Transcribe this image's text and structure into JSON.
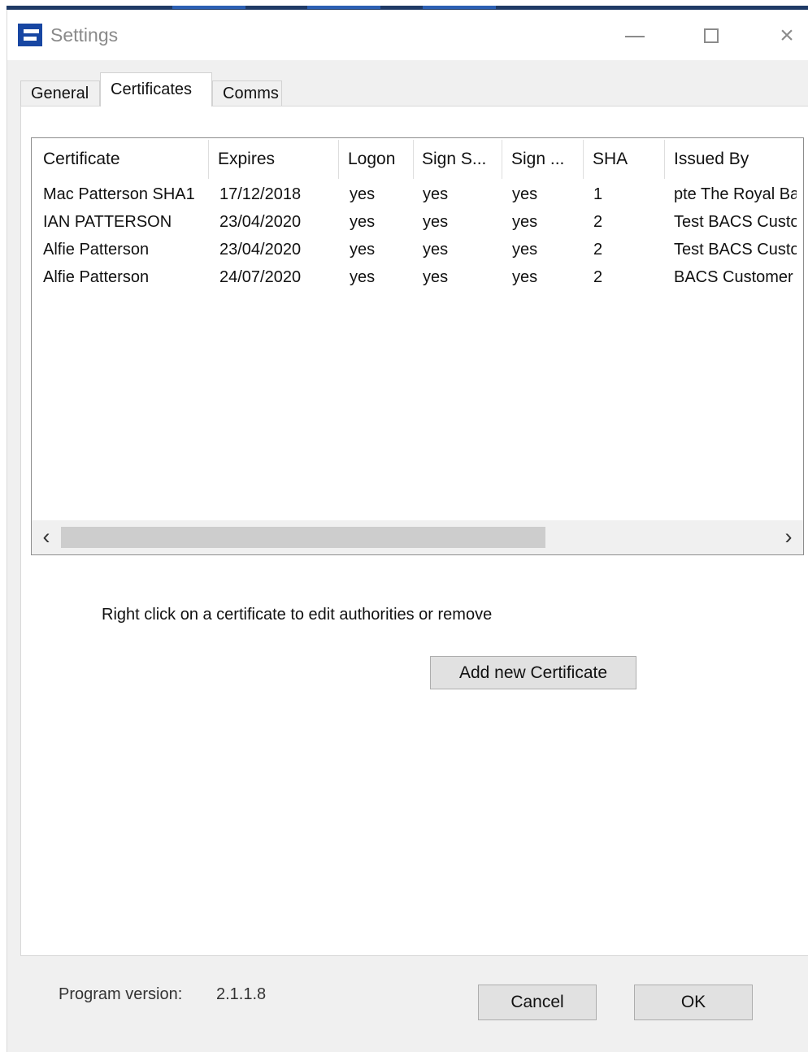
{
  "window": {
    "title": "Settings",
    "icon": "app-logo-icon",
    "controls": {
      "minimize": "window-minimize-icon",
      "maximize": "window-maximize-icon",
      "close": "window-close-icon",
      "close_glyph": "×"
    }
  },
  "tabs": [
    {
      "label": "General",
      "selected": false
    },
    {
      "label": "Certificates",
      "selected": true
    },
    {
      "label": "Comms",
      "selected": false
    }
  ],
  "certificates": {
    "columns": [
      "Certificate",
      "Expires",
      "Logon",
      "Sign S...",
      "Sign ...",
      "SHA",
      "Issued By"
    ],
    "rows": [
      [
        "Mac Patterson SHA1",
        "17/12/2018",
        "yes",
        "yes",
        "yes",
        "1",
        "pte The Royal Ba"
      ],
      [
        "IAN PATTERSON",
        "23/04/2020",
        "yes",
        "yes",
        "yes",
        "2",
        "Test BACS Custo"
      ],
      [
        "Alfie Patterson",
        "23/04/2020",
        "yes",
        "yes",
        "yes",
        "2",
        "Test BACS Custo"
      ],
      [
        "Alfie Patterson",
        "24/07/2020",
        "yes",
        "yes",
        "yes",
        "2",
        "BACS Customer"
      ]
    ],
    "horizontal_scroll": {
      "left_arrow": "‹",
      "right_arrow": "›",
      "thumb_fraction": 0.68
    }
  },
  "instructions": {
    "text": "Right click on a certificate to edit authorities or remove"
  },
  "buttons": {
    "add_certificate": "Add new Certificate",
    "cancel": "Cancel",
    "ok": "OK"
  },
  "footer": {
    "program_version_label": "Program version:",
    "program_version": "2.1.1.8"
  },
  "colors": {
    "accent": "#1746a2",
    "button_face": "#e1e1e1",
    "window_background": "#f0f0f0"
  }
}
